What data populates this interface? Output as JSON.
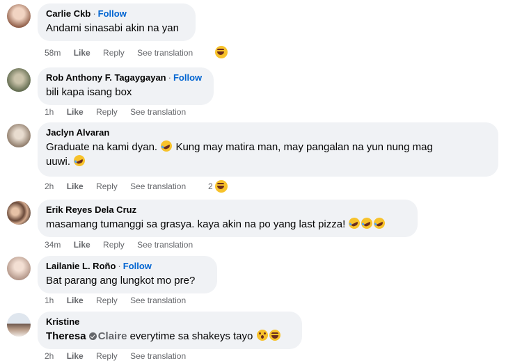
{
  "comments": [
    {
      "name": "Carlie Ckb",
      "follow": "Follow",
      "text": "Andami sinasabi akin na yan",
      "time": "58m",
      "like": "Like",
      "reply": "Reply",
      "translate": "See translation",
      "reaction_count": "",
      "avatar_color": "#d8b6a6"
    },
    {
      "name": "Rob Anthony F. Tagaygayan",
      "follow": "Follow",
      "text": "bili kapa isang box",
      "time": "1h",
      "like": "Like",
      "reply": "Reply",
      "translate": "See translation",
      "avatar_color": "#7c8c6a"
    },
    {
      "name": "Jaclyn Alvaran",
      "text_line1": "Graduate na kami dyan.",
      "text_line1b": "Kung may matira man, may pangalan na yun nung mag",
      "text_line2": "uuwi.",
      "time": "2h",
      "like": "Like",
      "reply": "Reply",
      "translate": "See translation",
      "reaction_count": "2",
      "avatar_color": "#b9a48d"
    },
    {
      "name": "Erik Reyes Dela Cruz",
      "text": "masamang tumanggi sa grasya. kaya akin na po yang last pizza!",
      "time": "34m",
      "like": "Like",
      "reply": "Reply",
      "translate": "See translation",
      "avatar_color": "#8a6f60"
    },
    {
      "name": "Lailanie L. Roño",
      "follow": "Follow",
      "text": "Bat parang ang lungkot mo pre?",
      "time": "1h",
      "like": "Like",
      "reply": "Reply",
      "translate": "See translation",
      "avatar_color": "#cdb4a8"
    },
    {
      "name": "Kristine",
      "mention1": "Theresa",
      "mention2": "Claire",
      "text": "everytime sa shakeys tayo",
      "time": "2h",
      "like": "Like",
      "reply": "Reply",
      "translate": "See translation",
      "avatar_color": "#9aa7b5"
    }
  ],
  "dot": "·",
  "colors": {
    "bubble": "#f0f2f5",
    "link": "#0064d1",
    "meta": "#65676b"
  }
}
